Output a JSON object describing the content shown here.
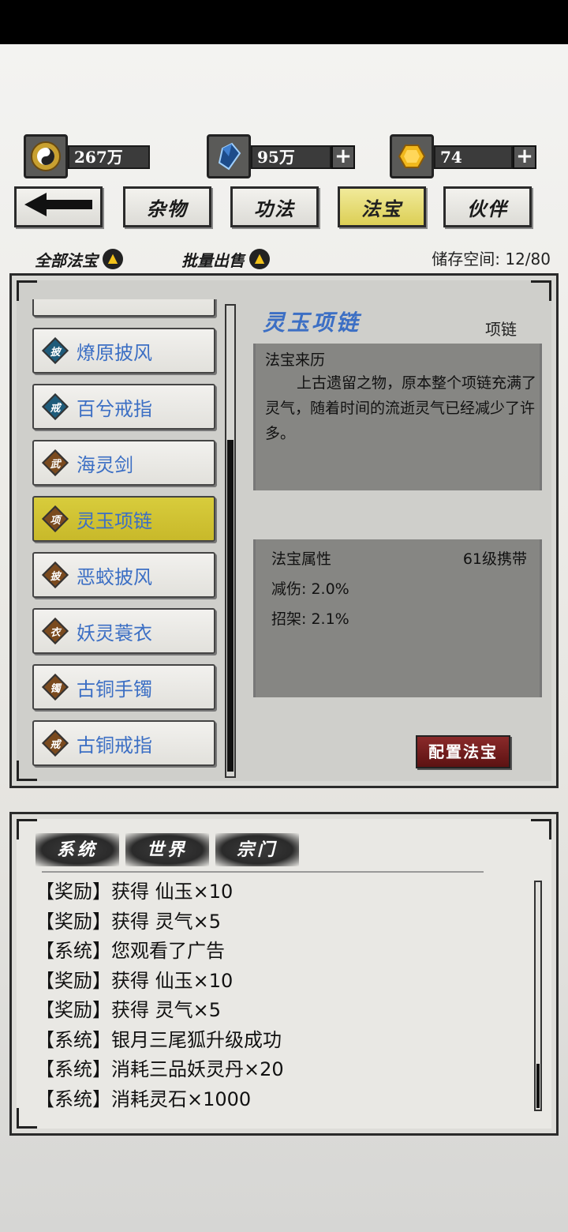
{
  "currencies": [
    {
      "icon": "yin-yang-coin-icon",
      "value": "267万",
      "has_add": false
    },
    {
      "icon": "blue-crystal-icon",
      "value": "95万",
      "has_add": true
    },
    {
      "icon": "gold-gem-icon",
      "value": "74",
      "has_add": true
    }
  ],
  "nav": {
    "back_icon": "back-arrow-icon",
    "tabs": [
      {
        "label": "杂物",
        "active": false
      },
      {
        "label": "功法",
        "active": false
      },
      {
        "label": "法宝",
        "active": true
      },
      {
        "label": "伙伴",
        "active": false
      }
    ]
  },
  "filters": {
    "all_label": "全部法宝",
    "bulk_sell_label": "批量出售",
    "storage_label": "储存空间:",
    "storage_value": "12/80"
  },
  "items": [
    {
      "badge": "披",
      "name": "燎原披风",
      "tier_color": "#1e5b7a"
    },
    {
      "badge": "戒",
      "name": "百兮戒指",
      "tier_color": "#1e5b7a"
    },
    {
      "badge": "武",
      "name": "海灵剑",
      "tier_color": "#7a4a1e"
    },
    {
      "badge": "项",
      "name": "灵玉项链",
      "tier_color": "#7a4a1e",
      "selected": true
    },
    {
      "badge": "披",
      "name": "恶蛟披风",
      "tier_color": "#7a4a1e"
    },
    {
      "badge": "衣",
      "name": "妖灵蓑衣",
      "tier_color": "#7a4a1e"
    },
    {
      "badge": "镯",
      "name": "古铜手镯",
      "tier_color": "#7a4a1e"
    },
    {
      "badge": "戒",
      "name": "古铜戒指",
      "tier_color": "#7a4a1e"
    }
  ],
  "detail": {
    "title": "灵玉项链",
    "type": "项链",
    "origin_heading": "法宝来历",
    "origin_text": "上古遗留之物，原本整个项链充满了灵气，随着时间的流逝灵气已经减少了许多。",
    "attr_heading": "法宝属性",
    "level_req": "61级携带",
    "attr1": "减伤: 2.0%",
    "attr2": "招架: 2.1%",
    "equip_label": "配置法宝"
  },
  "log": {
    "tabs": [
      "系统",
      "世界",
      "宗门"
    ],
    "lines": [
      "【奖励】获得 仙玉×10",
      "【奖励】获得 灵气×5",
      "【系统】您观看了广告",
      "【奖励】获得 仙玉×10",
      "【奖励】获得 灵气×5",
      "【系统】银月三尾狐升级成功",
      "【系统】消耗三品妖灵丹×20",
      "【系统】消耗灵石×1000"
    ]
  },
  "colors": {
    "item_name": "#3c6fc4",
    "selected_item": "#d2c535",
    "equip_button": "#7a1e1e"
  }
}
